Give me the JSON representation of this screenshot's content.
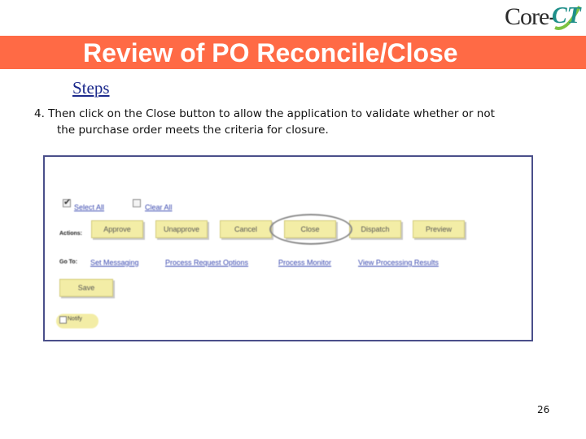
{
  "logo": {
    "core": "Core-",
    "ct": "CT"
  },
  "title": "Review of PO Reconcile/Close",
  "steps_heading": "Steps",
  "instruction": {
    "line1": "4. Then click on the Close button to allow the application to validate whether or not",
    "line2": "the purchase order meets the criteria for closure."
  },
  "screenshot": {
    "select_all": "Select All",
    "clear_all": "Clear All",
    "actions_label": "Actions:",
    "buttons": [
      "Approve",
      "Unapprove",
      "Cancel",
      "Close",
      "Dispatch",
      "Preview"
    ],
    "goto_label": "Go To:",
    "goto_links": [
      "Set Messaging",
      "Process Request Options",
      "Process Monitor",
      "View Processing Results"
    ],
    "save": "Save",
    "notify": "Notify"
  },
  "page_number": "26",
  "colors": {
    "title_bar": "#ff6a45",
    "steps": "#1c2a8c",
    "frame_border": "#4a4f8a",
    "button": "#f3eda6"
  }
}
